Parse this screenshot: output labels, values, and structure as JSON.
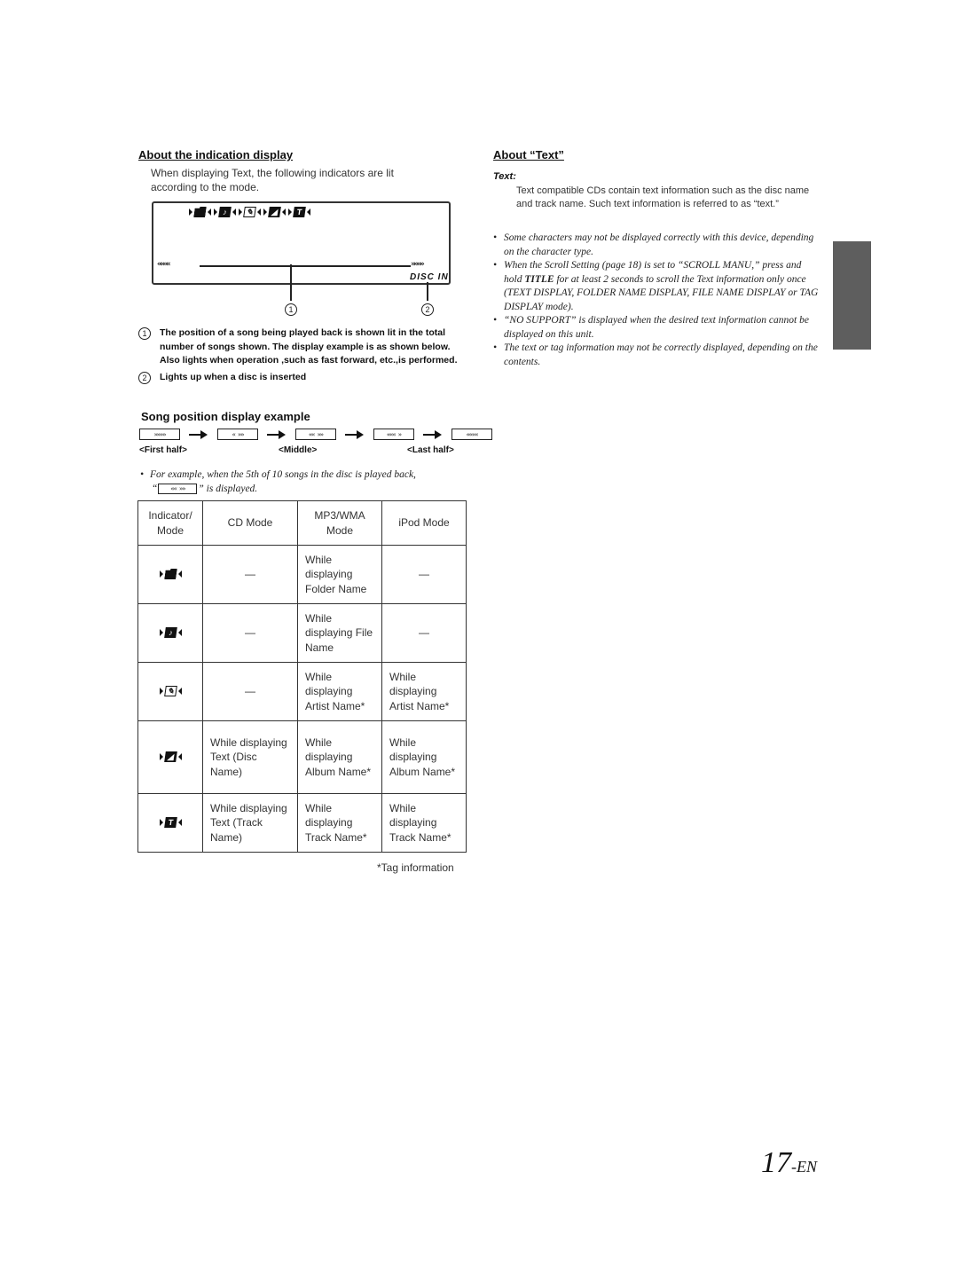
{
  "left": {
    "indication": {
      "heading": "About the indication display",
      "intro": "When displaying Text, the following indicators are lit according to the mode.",
      "lcd": {
        "indicators": [
          {
            "icon": "folder-icon",
            "glyph": ""
          },
          {
            "icon": "file-icon",
            "glyph": "♪"
          },
          {
            "icon": "artist-icon",
            "glyph": "✎"
          },
          {
            "icon": "album-icon",
            "glyph": "◢"
          },
          {
            "icon": "track-icon",
            "glyph": "T"
          }
        ],
        "left_chevrons": "««««",
        "right_chevrons": "»»»»",
        "disc_in": "DISC IN"
      },
      "callouts": [
        "1",
        "2"
      ],
      "notes": [
        {
          "num": "1",
          "text": "The position of a song being played back is shown lit in the total number of songs shown. The display example is as shown below. Also lights when operation ,such as fast forward, etc.,is performed."
        },
        {
          "num": "2",
          "text": "Lights up when a disc is inserted"
        }
      ]
    },
    "song_position": {
      "heading": "Song position display example",
      "boxes": [
        "»»»»",
        "«  »»",
        "««  »»",
        "«««  »",
        "««««"
      ],
      "labels": {
        "first": "<First half>",
        "middle": "<Middle>",
        "last": "<Last half>"
      },
      "example_prefix": "For example, when the 5th of 10 songs in the disc is played back,",
      "example_box": "««  »»",
      "example_suffix": "” is displayed.",
      "example_open_quote": "“"
    },
    "table": {
      "headers": [
        "Indicator/ Mode",
        "CD Mode",
        "MP3/WMA Mode",
        "iPod Mode"
      ],
      "rows": [
        {
          "indicator": "folder-icon",
          "glyph": "",
          "cd": "—",
          "mp3": "While displaying Folder Name",
          "ipod": "—"
        },
        {
          "indicator": "file-icon",
          "glyph": "♪",
          "cd": "—",
          "mp3": "While displaying File Name",
          "ipod": "—"
        },
        {
          "indicator": "artist-icon",
          "glyph": "✎",
          "cd": "—",
          "mp3": "While displaying Artist Name*",
          "ipod": "While displaying Artist Name*"
        },
        {
          "indicator": "album-icon",
          "glyph": "◢",
          "cd": "While displaying Text (Disc Name)",
          "mp3": "While displaying Album Name*",
          "ipod": "While displaying Album Name*"
        },
        {
          "indicator": "track-icon",
          "glyph": "T",
          "cd": "While displaying Text (Track Name)",
          "mp3": "While displaying Track Name*",
          "ipod": "While displaying Track Name*"
        }
      ],
      "footnote": "*Tag information"
    }
  },
  "right": {
    "heading": "About “Text”",
    "term": "Text:",
    "definition": "Text compatible CDs contain text information such as the disc name and track name. Such text information is referred to as “text.”",
    "bullets": [
      {
        "text": "Some characters may not be displayed correctly with this device, depending on the character type."
      },
      {
        "pre": "When the Scroll Setting (page 18) is set to “SCROLL MANU,” press and hold ",
        "bold": "TITLE",
        "post": " for at least 2 seconds to scroll the Text information only once (TEXT DISPLAY, FOLDER NAME DISPLAY, FILE NAME DISPLAY or TAG DISPLAY mode)."
      },
      {
        "text": "“NO SUPPORT” is displayed when the desired text information cannot be displayed on this unit."
      },
      {
        "text": "The text or tag information may not be correctly displayed, depending on the contents."
      }
    ]
  },
  "side_tab_color": "#5e5e5e",
  "page_number": {
    "num": "17",
    "suffix": "-EN"
  }
}
